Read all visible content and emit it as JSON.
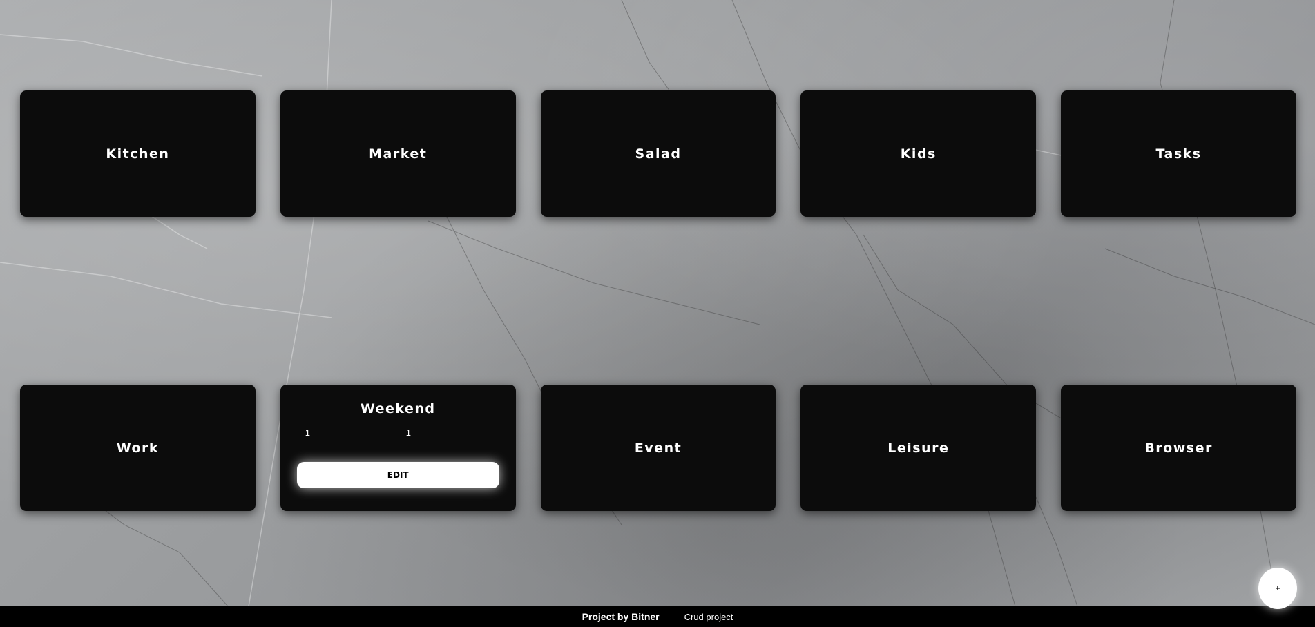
{
  "cards_row1": [
    {
      "title": "Kitchen"
    },
    {
      "title": "Market"
    },
    {
      "title": "Salad"
    },
    {
      "title": "Kids"
    },
    {
      "title": "Tasks"
    }
  ],
  "cards_row2": [
    {
      "title": "Work"
    },
    {
      "title": "Weekend",
      "count_left": "1",
      "count_right": "1",
      "edit_label": "EDIT"
    },
    {
      "title": "Event"
    },
    {
      "title": "Leisure"
    },
    {
      "title": "Browser"
    }
  ],
  "fab": {
    "label": "+"
  },
  "footer": {
    "credit": "Project by Bitner",
    "link": "Crud project"
  },
  "colors": {
    "card": "#0c0c0c",
    "footer": "#000000",
    "button": "#ffffff"
  }
}
